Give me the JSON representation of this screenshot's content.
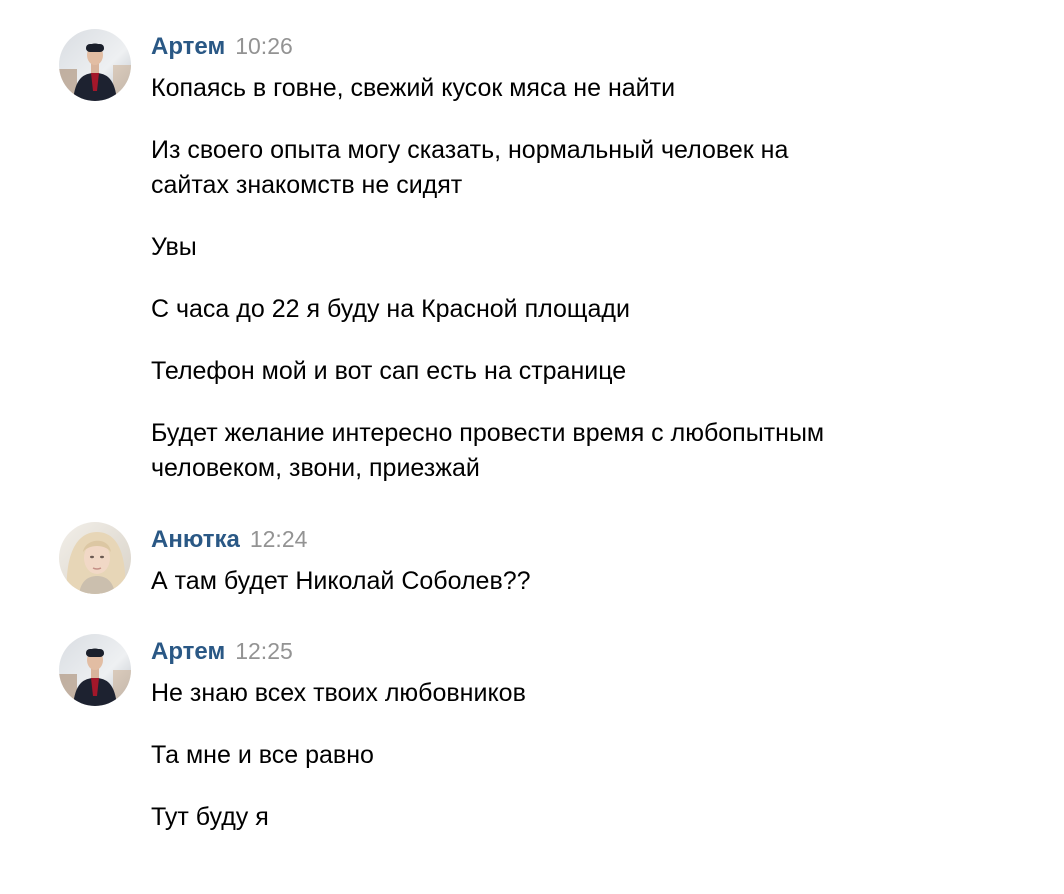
{
  "conversation": [
    {
      "author": "Артем",
      "time": "10:26",
      "avatar": "man-photo-avatar",
      "messages": [
        "Копаясь в говне, свежий кусок мяса не найти",
        "Из своего опыта могу сказать, нормальный человек на сайтах знакомств не сидят",
        "Увы",
        "С часа до 22 я буду на Красной площади",
        "Телефон мой и вот сап есть на странице",
        "Будет желание интересно провести время с любопытным человеком, звони, приезжай"
      ]
    },
    {
      "author": "Анютка",
      "time": "12:24",
      "avatar": "woman-photo-avatar",
      "messages": [
        "А там будет Николай Соболев??"
      ]
    },
    {
      "author": "Артем",
      "time": "12:25",
      "avatar": "man-photo-avatar",
      "messages": [
        "Не знаю всех твоих любовников",
        "Та мне и все равно",
        "Тут буду я"
      ]
    }
  ],
  "colors": {
    "author_link": "#2a5885",
    "timestamp": "#939393",
    "message_text": "#000000",
    "background": "#ffffff"
  }
}
